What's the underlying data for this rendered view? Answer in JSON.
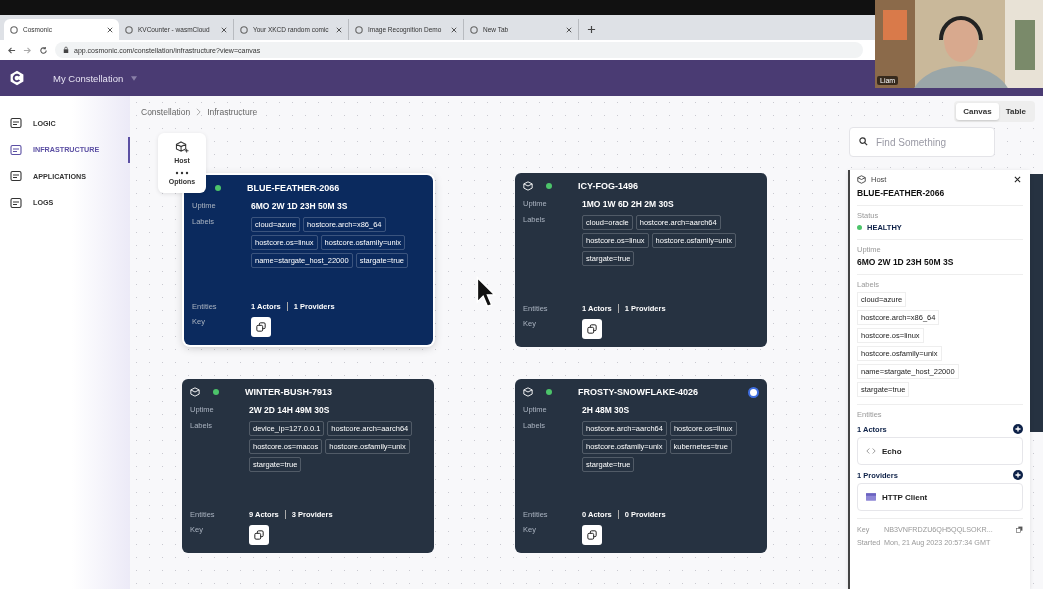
{
  "browser": {
    "tabs": [
      {
        "title": "Cosmonic",
        "selected": true
      },
      {
        "title": "KVCounter - wasmCloud",
        "selected": false
      },
      {
        "title": "Your XKCD random comic",
        "selected": false
      },
      {
        "title": "Image Recognition Demo",
        "selected": false
      },
      {
        "title": "New Tab",
        "selected": false
      }
    ],
    "url": "app.cosmonic.com/constellation/infrastructure?view=canvas"
  },
  "header": {
    "workspace": "My Constellation"
  },
  "webcam": {
    "kind": "picture",
    "name": "Liam"
  },
  "sidebar": {
    "items": [
      {
        "label": "LOGIC",
        "selected": false
      },
      {
        "label": "INFRASTRUCTURE",
        "selected": true
      },
      {
        "label": "APPLICATIONS",
        "selected": false
      },
      {
        "label": "LOGS",
        "selected": false
      }
    ]
  },
  "breadcrumb": [
    "Constellation",
    "Infrastructure"
  ],
  "view_toggle": [
    {
      "label": "Canvas",
      "selected": true
    },
    {
      "label": "Table",
      "selected": false
    }
  ],
  "toolbar": [
    {
      "label": "Host"
    },
    {
      "label": "Options"
    }
  ],
  "search": {
    "placeholder": "Find Something"
  },
  "hosts": [
    {
      "name": "BLUE-FEATHER-2066",
      "selected": true,
      "badge": false,
      "uptime_label": "Uptime",
      "uptime": "6MO 2W 1D 23H 50M 3S",
      "labels_label": "Labels",
      "labels": [
        "cloud=azure",
        "hostcore.arch=x86_64",
        "hostcore.os=linux",
        "hostcore.osfamily=unix",
        "name=stargate_host_22000",
        "stargate=true"
      ],
      "entities_label": "Entities",
      "actors": "1 Actors",
      "providers": "1 Providers",
      "key_label": "Key"
    },
    {
      "name": "ICY-FOG-1496",
      "selected": false,
      "badge": false,
      "uptime_label": "Uptime",
      "uptime": "1MO 1W 6D 2H 2M 30S",
      "labels_label": "Labels",
      "labels": [
        "cloud=oracle",
        "hostcore.arch=aarch64",
        "hostcore.os=linux",
        "hostcore.osfamily=unix",
        "stargate=true"
      ],
      "entities_label": "Entities",
      "actors": "1 Actors",
      "providers": "1 Providers",
      "key_label": "Key"
    },
    {
      "name": "WINTER-BUSH-7913",
      "selected": false,
      "badge": false,
      "uptime_label": "Uptime",
      "uptime": "2W 2D 14H 49M 30S",
      "labels_label": "Labels",
      "labels": [
        "device_ip=127.0.0.1",
        "hostcore.arch=aarch64",
        "hostcore.os=macos",
        "hostcore.osfamily=unix",
        "stargate=true"
      ],
      "entities_label": "Entities",
      "actors": "9 Actors",
      "providers": "3 Providers",
      "key_label": "Key"
    },
    {
      "name": "FROSTY-SNOWFLAKE-4026",
      "selected": false,
      "badge": true,
      "uptime_label": "Uptime",
      "uptime": "2H 48M 30S",
      "labels_label": "Labels",
      "labels": [
        "hostcore.arch=aarch64",
        "hostcore.os=linux",
        "hostcore.osfamily=unix",
        "kubernetes=true",
        "stargate=true"
      ],
      "entities_label": "Entities",
      "actors": "0 Actors",
      "providers": "0 Providers",
      "key_label": "Key"
    }
  ],
  "details": {
    "type": "Host",
    "name": "BLUE-FEATHER-2066",
    "status_label": "Status",
    "status": "HEALTHY",
    "uptime_label": "Uptime",
    "uptime": "6MO 2W 1D 23H 50M 3S",
    "labels_label": "Labels",
    "labels": [
      "cloud=azure",
      "hostcore.arch=x86_64",
      "hostcore.os=linux",
      "hostcore.osfamily=unix",
      "name=stargate_host_22000",
      "stargate=true"
    ],
    "entities_label": "Entities",
    "actors_heading": "1 Actors",
    "actors": [
      {
        "name": "Echo"
      }
    ],
    "providers_heading": "1 Providers",
    "providers": [
      {
        "name": "HTTP Client"
      }
    ],
    "key_label": "Key",
    "key": "NB3VNFRDZU6QH5QQLSOKR...",
    "started_label": "Started",
    "started": "Mon, 21 Aug 2023 20:57:34 GMT"
  }
}
